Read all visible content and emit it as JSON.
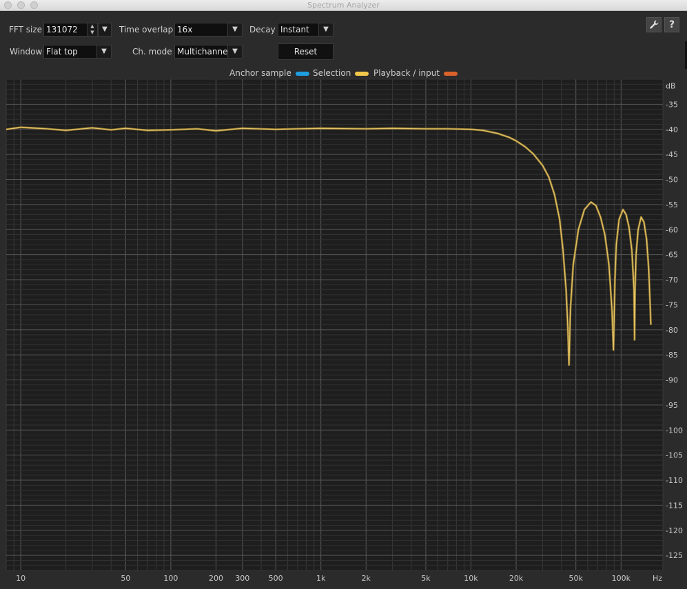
{
  "window": {
    "title": "Spectrum Analyzer"
  },
  "controls": {
    "fft_size": {
      "label": "FFT size",
      "value": "131072"
    },
    "time_overlap": {
      "label": "Time overlap",
      "value": "16x"
    },
    "decay": {
      "label": "Decay",
      "value": "Instant"
    },
    "window_fn": {
      "label": "Window",
      "value": "Flat top"
    },
    "ch_mode": {
      "label": "Ch. mode",
      "value": "Multichannel"
    },
    "reset_label": "Reset",
    "settings_icon": "wrench-icon",
    "help_label": "?"
  },
  "legend": [
    {
      "label": "Anchor sample",
      "color": "#1e9ee0"
    },
    {
      "label": "Selection",
      "color": "#f2c84b"
    },
    {
      "label": "Playback / input",
      "color": "#d9622b"
    }
  ],
  "chart_data": {
    "type": "line",
    "title": "",
    "xlabel": "Hz",
    "ylabel": "dB",
    "x_scale": "log",
    "xlim": [
      8,
      190000
    ],
    "ylim": [
      -128,
      -30
    ],
    "grid": true,
    "x_tick_labels": [
      "10",
      "50",
      "100",
      "200",
      "300",
      "500",
      "1k",
      "2k",
      "5k",
      "10k",
      "20k",
      "50k",
      "100k",
      "Hz"
    ],
    "x_ticks": [
      10,
      50,
      100,
      200,
      300,
      500,
      1000,
      2000,
      5000,
      10000,
      20000,
      50000,
      100000
    ],
    "y_tick_labels": [
      "dB",
      "-35",
      "-40",
      "-45",
      "-50",
      "-55",
      "-60",
      "-65",
      "-70",
      "-75",
      "-80",
      "-85",
      "-90",
      "-95",
      "-100",
      "-105",
      "-110",
      "-115",
      "-120",
      "-125"
    ],
    "y_ticks": [
      -35,
      -40,
      -45,
      -50,
      -55,
      -60,
      -65,
      -70,
      -75,
      -80,
      -85,
      -90,
      -95,
      -100,
      -105,
      -110,
      -115,
      -120,
      -125
    ],
    "series": [
      {
        "name": "Selection",
        "color": "#e8c463",
        "x": [
          8,
          10,
          15,
          20,
          30,
          40,
          50,
          70,
          100,
          150,
          200,
          300,
          500,
          700,
          1000,
          2000,
          3000,
          5000,
          7000,
          10000,
          12000,
          15000,
          18000,
          20000,
          23000,
          26000,
          30000,
          33000,
          36000,
          39000,
          41000,
          43000,
          44000,
          45000,
          46000,
          48000,
          52000,
          57000,
          63000,
          68000,
          73000,
          78000,
          83000,
          87000,
          89000,
          90000,
          91000,
          93000,
          97000,
          103000,
          108000,
          113000,
          118000,
          122000,
          123000,
          124000,
          126000,
          130000,
          136000,
          142000,
          148000,
          153000,
          158000
        ],
        "y": [
          -40,
          -39.6,
          -39.9,
          -40.2,
          -39.7,
          -40.1,
          -39.8,
          -40.2,
          -40.1,
          -39.9,
          -40.3,
          -39.8,
          -40.0,
          -39.9,
          -39.8,
          -39.9,
          -39.8,
          -39.9,
          -39.9,
          -40.0,
          -40.2,
          -40.8,
          -41.6,
          -42.3,
          -43.5,
          -44.9,
          -47.2,
          -49.5,
          -53,
          -58,
          -64,
          -72,
          -78,
          -87,
          -76,
          -67,
          -60,
          -56,
          -54.5,
          -55.2,
          -57.5,
          -61,
          -67,
          -76,
          -84,
          -78,
          -70,
          -63,
          -58,
          -56,
          -57,
          -59.5,
          -64,
          -72,
          -82,
          -72,
          -65,
          -60,
          -57.5,
          -58.5,
          -62,
          -68,
          -79
        ]
      }
    ]
  }
}
